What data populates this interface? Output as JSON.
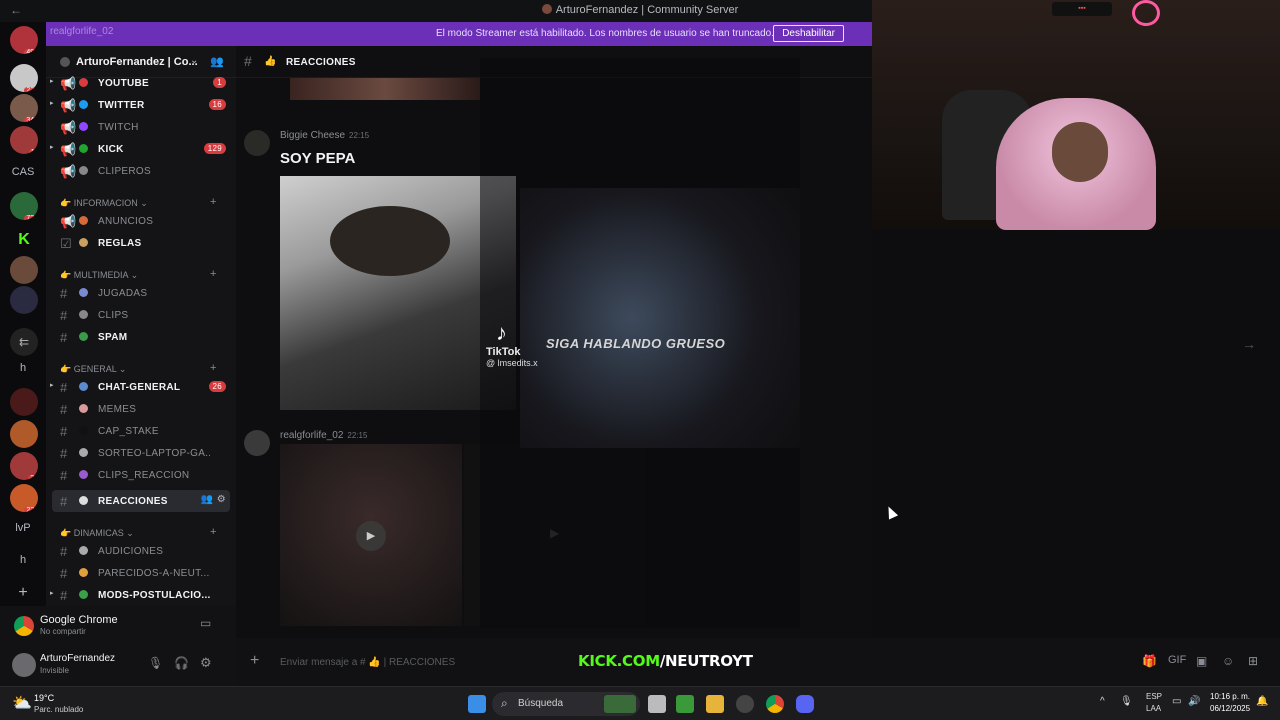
{
  "window": {
    "title": "ArturoFernandez | Community Server"
  },
  "banner": {
    "user": "realgforlife_02",
    "message": "El modo Streamer está habilitado. Los nombres de usuario se han truncado.",
    "button": "Deshabilitar"
  },
  "rail": {
    "badges": [
      "496",
      "227",
      "345",
      "11",
      "721",
      "1",
      "21",
      "221"
    ],
    "labels": [
      "CAS",
      "h",
      "lvP",
      "h"
    ]
  },
  "server": {
    "name": "ArturoFernandez | Co..."
  },
  "channels_top": [
    {
      "label": "YOUTUBE",
      "count": "1",
      "color": "#d83c3e",
      "bold": true
    },
    {
      "label": "TWITTER",
      "count": "16",
      "color": "#1d9bf0",
      "bold": true
    },
    {
      "label": "TWITCH",
      "count": "",
      "color": "#9146ff",
      "bold": false
    },
    {
      "label": "KICK",
      "count": "129",
      "color": "#53fc18",
      "bold": true
    },
    {
      "label": "CLIPEROS",
      "count": "",
      "color": "#888",
      "bold": false
    }
  ],
  "categories": {
    "info": "INFORMACION",
    "multimedia": "MULTIMEDIA",
    "general": "GENERAL",
    "dinamicas": "DINAMICAS"
  },
  "channels_info": [
    {
      "label": "ANUNCIOS",
      "bold": false
    },
    {
      "label": "REGLAS",
      "bold": true
    }
  ],
  "channels_multimedia": [
    {
      "label": "JUGADAS",
      "bold": false
    },
    {
      "label": "CLIPS",
      "bold": false
    },
    {
      "label": "SPAM",
      "bold": true
    }
  ],
  "channels_general": [
    {
      "label": "CHAT-GENERAL",
      "count": "26",
      "bold": true
    },
    {
      "label": "MEMES",
      "count": "",
      "bold": false
    },
    {
      "label": "CAP_STAKE",
      "count": "",
      "bold": false
    },
    {
      "label": "SORTEO-LAPTOP-GA...",
      "count": "",
      "bold": false
    },
    {
      "label": "CLIPS_REACCION",
      "count": "",
      "bold": false
    },
    {
      "label": "REACCIONES",
      "count": "",
      "bold": true
    }
  ],
  "channels_dinamicas": [
    {
      "label": "AUDICIONES",
      "bold": false
    },
    {
      "label": "PARECIDOS-A-NEUT...",
      "bold": false
    },
    {
      "label": "MODS-POSTULACIO...",
      "bold": true
    }
  ],
  "activity": {
    "app": "Google Chrome",
    "status": "No compartir"
  },
  "user": {
    "name": "ArturoFernandez",
    "status": "Invisible"
  },
  "channel": {
    "name": "REACCIONES"
  },
  "messages": [
    {
      "author": "Biggie Cheese",
      "time": "22:15",
      "text": "SOY PEPA"
    },
    {
      "author": "realgforlife_02",
      "time": "22:15",
      "text": ""
    }
  ],
  "media": {
    "tiktok_brand": "TikTok",
    "tiktok_handle": "@ lmsedits.x",
    "caption": "SIGA HABLANDO GRUESO"
  },
  "composer": {
    "placeholder": "Enviar mensaje a #",
    "channel": "REACCIONES"
  },
  "kick_overlay": {
    "prefix": "KICK.COM",
    "suffix": "/NEUTROYT"
  },
  "taskbar": {
    "weather_temp": "19°C",
    "weather_desc": "Parc. nublado",
    "search": "Búsqueda",
    "lang": "ESP",
    "layout": "LAA",
    "time": "10:16 p. m.",
    "date": "06/12/2025"
  }
}
